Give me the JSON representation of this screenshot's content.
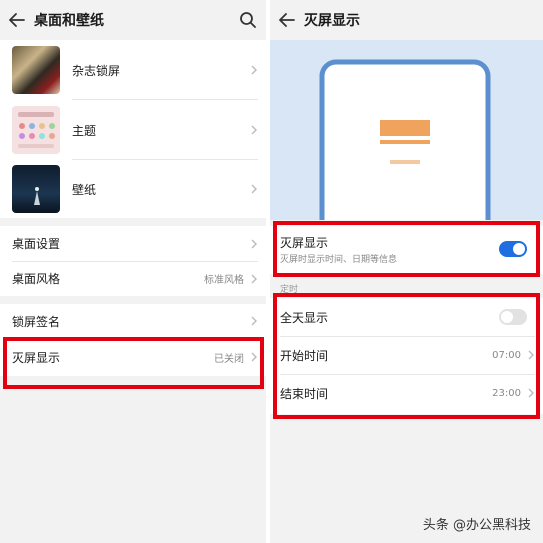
{
  "left": {
    "title": "桌面和壁纸",
    "gallery": [
      {
        "label": "杂志锁屏"
      },
      {
        "label": "主题"
      },
      {
        "label": "壁纸"
      }
    ],
    "settings": [
      {
        "label": "桌面设置",
        "value": ""
      },
      {
        "label": "桌面风格",
        "value": "标准风格"
      }
    ],
    "lock": [
      {
        "label": "锁屏签名",
        "value": ""
      },
      {
        "label": "灭屏显示",
        "value": "已关闭"
      }
    ]
  },
  "right": {
    "title": "灭屏显示",
    "aod": {
      "label": "灭屏显示",
      "subtitle": "灭屏时显示时间、日期等信息",
      "enabled": true
    },
    "timing_header": "定时",
    "allday": {
      "label": "全天显示",
      "enabled": false
    },
    "start": {
      "label": "开始时间",
      "value": "07:00"
    },
    "end": {
      "label": "结束时间",
      "value": "23:00"
    }
  },
  "watermark": "头条 @办公黑科技",
  "colors": {
    "accent": "#1f6fe0",
    "highlight": "#e3000f",
    "preview_block": "#f0a35c"
  },
  "icons": [
    "back-arrow-icon",
    "search-icon",
    "chevron-right-icon"
  ]
}
